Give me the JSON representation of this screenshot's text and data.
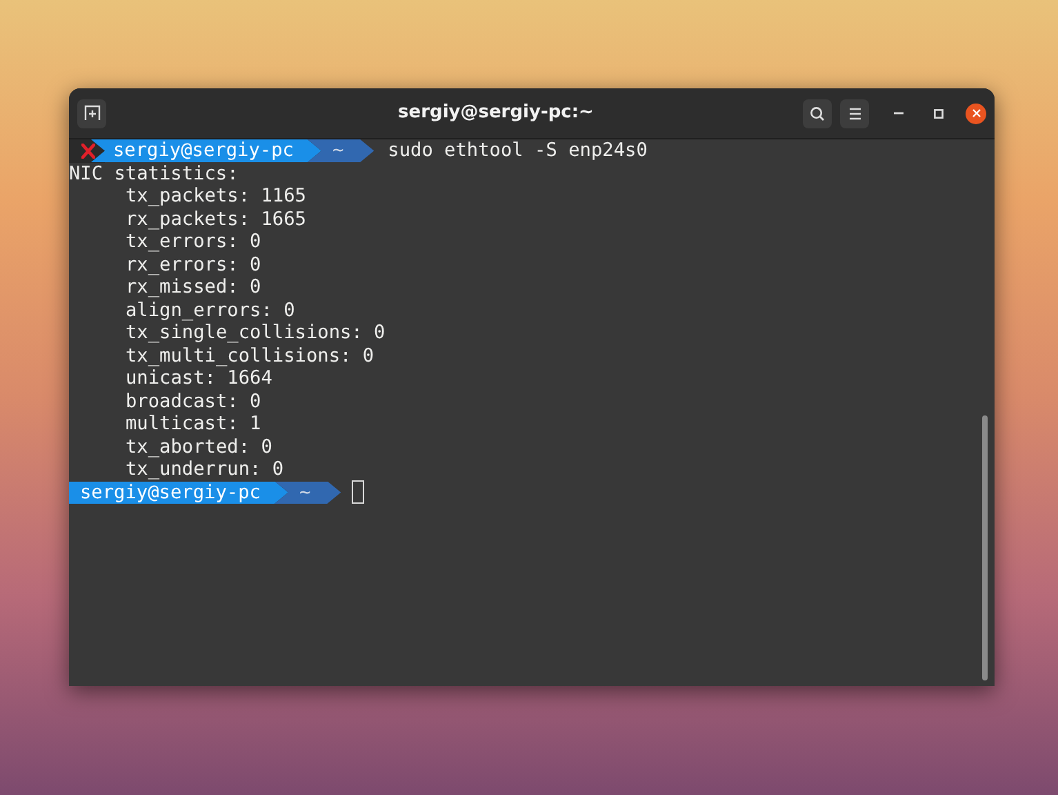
{
  "window": {
    "title": "sergiy@sergiy-pc:~"
  },
  "prompts": [
    {
      "failed": true,
      "user_host": "sergiy@sergiy-pc",
      "directory": "~",
      "command": "sudo ethtool -S enp24s0",
      "cursor": false,
      "output": {
        "heading": "NIC statistics:",
        "children": [
          "tx_packets: 1165",
          "rx_packets: 1665",
          "tx_errors: 0",
          "rx_errors: 0",
          "rx_missed: 0",
          "align_errors: 0",
          "tx_single_collisions: 0",
          "tx_multi_collisions: 0",
          "unicast: 1664",
          "broadcast: 0",
          "multicast: 1",
          "tx_aborted: 0",
          "tx_underrun: 0"
        ]
      }
    },
    {
      "failed": false,
      "user_host": "sergiy@sergiy-pc",
      "directory": "~",
      "cursor": true
    }
  ]
}
